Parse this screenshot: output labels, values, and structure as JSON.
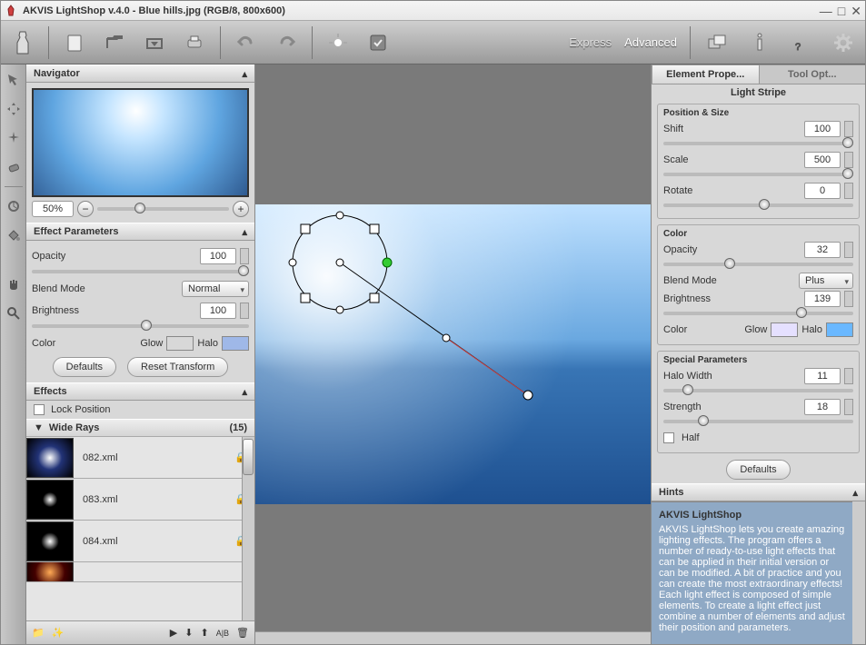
{
  "title": "AKVIS LightShop v.4.0 - Blue hills.jpg (RGB/8, 800x600)",
  "modes": {
    "express": "Express",
    "advanced": "Advanced"
  },
  "navigator": {
    "title": "Navigator",
    "zoom": "50%"
  },
  "effect_params": {
    "title": "Effect Parameters",
    "opacity_label": "Opacity",
    "opacity": "100",
    "blend_label": "Blend Mode",
    "blend": "Normal",
    "brightness_label": "Brightness",
    "brightness": "100",
    "color_label": "Color",
    "glow_label": "Glow",
    "halo_label": "Halo",
    "glow_color": "#ffffff",
    "halo_color": "#9fb8e8",
    "defaults": "Defaults",
    "reset": "Reset Transform"
  },
  "effects": {
    "title": "Effects",
    "lock_label": "Lock Position",
    "group": "Wide Rays",
    "count": "(15)",
    "items": [
      "082.xml",
      "083.xml",
      "084.xml"
    ]
  },
  "right": {
    "tab1": "Element Prope...",
    "tab2": "Tool Opt...",
    "element": "Light Stripe",
    "pos_size": "Position & Size",
    "shift_label": "Shift",
    "shift": "100",
    "scale_label": "Scale",
    "scale": "500",
    "rotate_label": "Rotate",
    "rotate": "0",
    "color_section": "Color",
    "opacity_label": "Opacity",
    "opacity": "32",
    "blend_label": "Blend Mode",
    "blend": "Plus",
    "brightness_label": "Brightness",
    "brightness": "139",
    "color_label": "Color",
    "glow_label": "Glow",
    "halo_label": "Halo",
    "glow_color": "#e5e0ff",
    "halo_color": "#6ab8ff",
    "special": "Special Parameters",
    "halo_w_label": "Halo Width",
    "halo_w": "11",
    "strength_label": "Strength",
    "strength": "18",
    "half_label": "Half",
    "defaults": "Defaults"
  },
  "hints": {
    "title": "Hints",
    "heading": "AKVIS LightShop",
    "body": "AKVIS LightShop lets you create amazing lighting effects. The program offers a number of ready-to-use light effects that can be applied in their initial version or can be modified. A bit of practice and you can create the most extraordinary effects!\nEach light effect is composed of simple elements. To create a light effect just combine a number of elements and adjust their position and parameters."
  }
}
